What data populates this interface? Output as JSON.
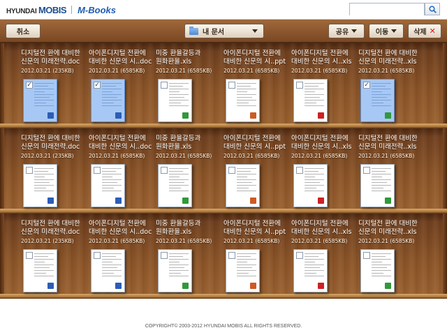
{
  "header": {
    "brand": "HYUNDAI",
    "brand_strong": "MOBIS",
    "app_name": "M-Books",
    "search": {
      "value": "",
      "placeholder": ""
    },
    "search_icon": "magnifier-icon"
  },
  "toolbar": {
    "cancel_label": "취소",
    "folder_label": "내 문서",
    "share_label": "공유",
    "move_label": "이동",
    "delete_label": "삭제",
    "accent_color": "#1e5db3"
  },
  "shelves": [
    {
      "books": [
        {
          "title_line1": "디지털전 환에 대비한",
          "title_line2": "신문의 미래전략.doc",
          "meta": "2012.03.21 (235KB)",
          "type": "doc",
          "selected": true
        },
        {
          "title_line1": "아이폰디지털 전환에",
          "title_line2": "대비한 신문의 시..doc",
          "meta": "2012.03.21 (6585KB)",
          "type": "doc",
          "selected": true
        },
        {
          "title_line1": "미중 환율갈등과",
          "title_line2": "원화환율.xls",
          "meta": "2012.03.21 (6585KB)",
          "type": "xls",
          "selected": false
        },
        {
          "title_line1": "아이폰디지털 전환에",
          "title_line2": "대비한 신문의 시..ppt",
          "meta": "2012.03.21 (6585KB)",
          "type": "ppt",
          "selected": false
        },
        {
          "title_line1": "아이폰디지털 전환에",
          "title_line2": "대비한 신문의 시..xls",
          "meta": "2012.03.21 (6585KB)",
          "type": "pdf",
          "selected": false
        },
        {
          "title_line1": "디지털전 환에 대비한",
          "title_line2": "신문의 미래전략..xls",
          "meta": "2012.03.21 (6585KB)",
          "type": "xls",
          "selected": true
        }
      ]
    },
    {
      "books": [
        {
          "title_line1": "디지털전 환에 대비한",
          "title_line2": "신문의 미래전략.doc",
          "meta": "2012.03.21 (235KB)",
          "type": "doc",
          "selected": false
        },
        {
          "title_line1": "아이폰디지털 전환에",
          "title_line2": "대비한 신문의 시..doc",
          "meta": "2012.03.21 (6585KB)",
          "type": "doc",
          "selected": false
        },
        {
          "title_line1": "미중 환율갈등과",
          "title_line2": "원화환율.xls",
          "meta": "2012.03.21 (6585KB)",
          "type": "xls",
          "selected": false
        },
        {
          "title_line1": "아이폰디지털 전환에",
          "title_line2": "대비한 신문의 시..ppt",
          "meta": "2012.03.21 (6585KB)",
          "type": "ppt",
          "selected": false
        },
        {
          "title_line1": "아이폰디지털 전환에",
          "title_line2": "대비한 신문의 시..xls",
          "meta": "2012.03.21 (6585KB)",
          "type": "pdf",
          "selected": false
        },
        {
          "title_line1": "디지털전 환에 대비한",
          "title_line2": "신문의 미래전략..xls",
          "meta": "2012.03.21 (6585KB)",
          "type": "xls",
          "selected": false
        }
      ]
    },
    {
      "books": [
        {
          "title_line1": "디지털전 환에 대비한",
          "title_line2": "신문의 미래전략.doc",
          "meta": "2012.03.21 (235KB)",
          "type": "doc",
          "selected": false
        },
        {
          "title_line1": "아이폰디지털 전환에",
          "title_line2": "대비한 신문의 시..doc",
          "meta": "2012.03.21 (6585KB)",
          "type": "doc",
          "selected": false
        },
        {
          "title_line1": "미중 환율갈등과",
          "title_line2": "원화환율.xls",
          "meta": "2012.03.21 (6585KB)",
          "type": "xls",
          "selected": false
        },
        {
          "title_line1": "아이폰디지털 전환에",
          "title_line2": "대비한 신문의 시..ppt",
          "meta": "2012.03.21 (6585KB)",
          "type": "ppt",
          "selected": false
        },
        {
          "title_line1": "아이폰디지털 전환에",
          "title_line2": "대비한 신문의 시..xls",
          "meta": "2012.03.21 (6585KB)",
          "type": "pdf",
          "selected": false
        },
        {
          "title_line1": "디지털전 환에 대비한",
          "title_line2": "신문의 미래전략..xls",
          "meta": "2012.03.21 (6585KB)",
          "type": "xls",
          "selected": false
        }
      ]
    }
  ],
  "footer": {
    "copyright": "COPYRIGHT© 2003-2012 HYUNDAI MOBIS ALL RIGHTS RESERVED."
  }
}
